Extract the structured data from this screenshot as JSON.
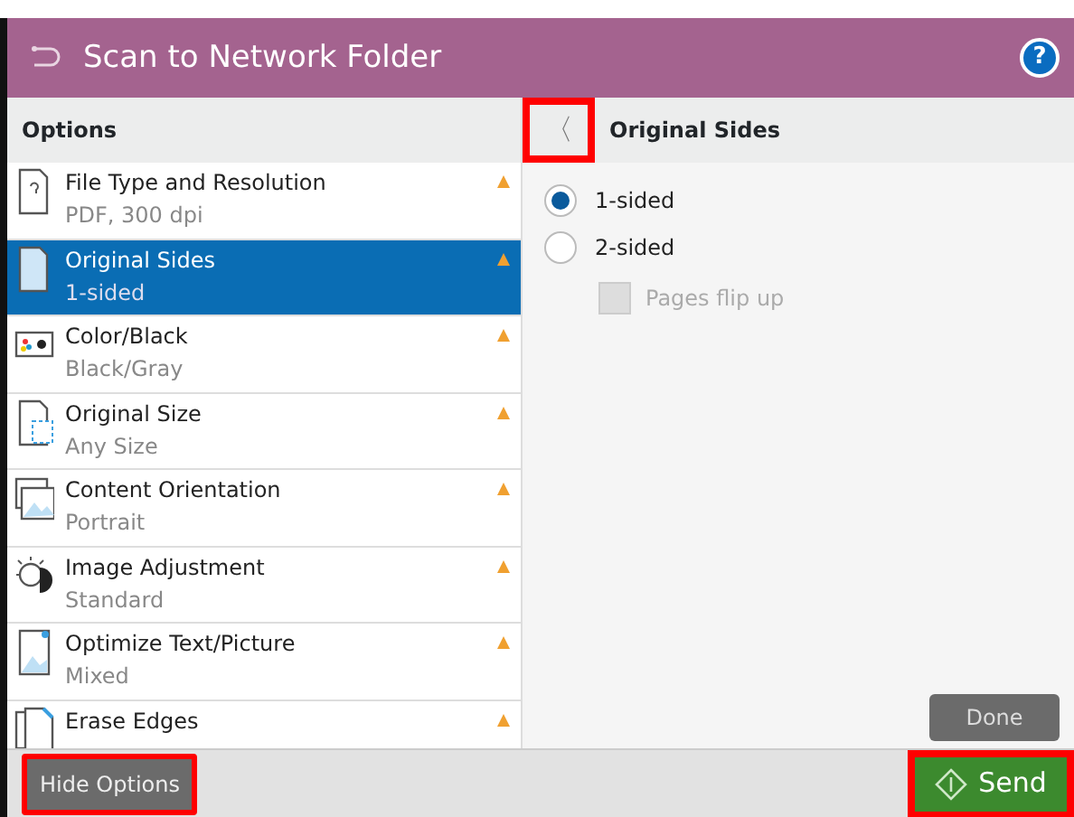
{
  "header": {
    "title": "Scan to Network Folder",
    "help": "?"
  },
  "options_panel": {
    "title": "Options",
    "items": [
      {
        "kind": "file",
        "title": "File Type and Resolution",
        "value": "PDF, 300 dpi",
        "selected": false
      },
      {
        "kind": "page",
        "title": "Original Sides",
        "value": "1-sided",
        "selected": true
      },
      {
        "kind": "color",
        "title": "Color/Black",
        "value": "Black/Gray",
        "selected": false
      },
      {
        "kind": "size",
        "title": "Original Size",
        "value": "Any Size",
        "selected": false
      },
      {
        "kind": "orient",
        "title": "Content Orientation",
        "value": "Portrait",
        "selected": false
      },
      {
        "kind": "sun",
        "title": "Image Adjustment",
        "value": "Standard",
        "selected": false
      },
      {
        "kind": "picture",
        "title": "Optimize Text/Picture",
        "value": "Mixed",
        "selected": false
      },
      {
        "kind": "erase",
        "title": "Erase Edges",
        "selected": false
      }
    ]
  },
  "detail": {
    "back": "〈",
    "back_highlighted": true,
    "title": "Original Sides",
    "radios": [
      {
        "label": "1-sided",
        "selected": true
      },
      {
        "label": "2-sided",
        "selected": false
      }
    ],
    "checkbox": {
      "label": "Pages flip up",
      "checked": false,
      "disabled": true
    },
    "done": "Done"
  },
  "footer": {
    "hide_options": "Hide Options",
    "hide_highlighted": true,
    "send": "Send",
    "send_highlighted": true
  }
}
